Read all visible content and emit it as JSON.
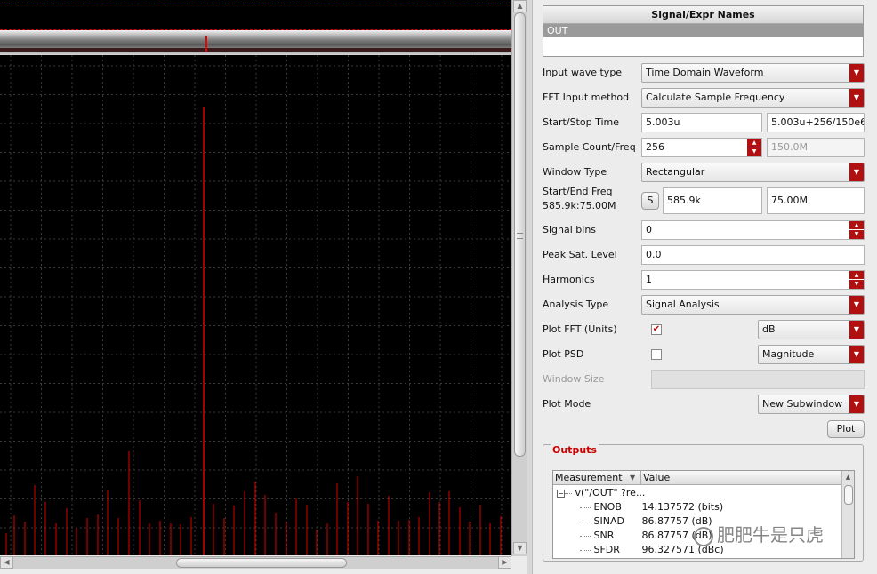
{
  "signal_box": {
    "header": "Signal/Expr Names",
    "selected": "OUT"
  },
  "form": {
    "input_wave_type": {
      "label": "Input wave type",
      "value": "Time Domain Waveform"
    },
    "fft_input_method": {
      "label": "FFT Input method",
      "value": "Calculate Sample Frequency"
    },
    "start_stop_time": {
      "label": "Start/Stop Time",
      "start": "5.003u",
      "stop": "5.003u+256/150e6"
    },
    "sample_count": {
      "label": "Sample Count/Freq",
      "count": "256",
      "freq": "150.0M"
    },
    "window_type": {
      "label": "Window Type",
      "value": "Rectangular"
    },
    "start_end_freq": {
      "label": "Start/End Freq",
      "sublabel": "585.9k:75.00M",
      "s_button": "S",
      "start": "585.9k",
      "end": "75.00M"
    },
    "signal_bins": {
      "label": "Signal bins",
      "value": "0"
    },
    "peak_sat_level": {
      "label": "Peak Sat. Level",
      "value": "0.0"
    },
    "harmonics": {
      "label": "Harmonics",
      "value": "1"
    },
    "analysis_type": {
      "label": "Analysis Type",
      "value": "Signal Analysis"
    },
    "plot_fft": {
      "label": "Plot FFT (Units)",
      "checked": true,
      "check_glyph": "✔",
      "units": "dB"
    },
    "plot_psd": {
      "label": "Plot PSD",
      "checked": false,
      "check_glyph": "",
      "mode": "Magnitude"
    },
    "window_size": {
      "label": "Window Size",
      "value": ""
    },
    "plot_mode": {
      "label": "Plot Mode",
      "value": "New Subwindow"
    },
    "plot_button": "Plot"
  },
  "outputs": {
    "title": "Outputs",
    "columns": [
      "Measurement",
      "Value"
    ],
    "group": "v(\"/OUT\" ?re...",
    "rows": [
      {
        "name": "ENOB",
        "value": "14.137572 (bits)"
      },
      {
        "name": "SINAD",
        "value": "86.87757 (dB)"
      },
      {
        "name": "SNR",
        "value": "86.87757 (dB)"
      },
      {
        "name": "SFDR",
        "value": "96.327571 (dBc)"
      }
    ]
  },
  "watermark": "肥肥牛是只虎",
  "colors": {
    "accent_red": "#b01010",
    "trace_red": "#e00000",
    "plot_bg": "#000000"
  }
}
